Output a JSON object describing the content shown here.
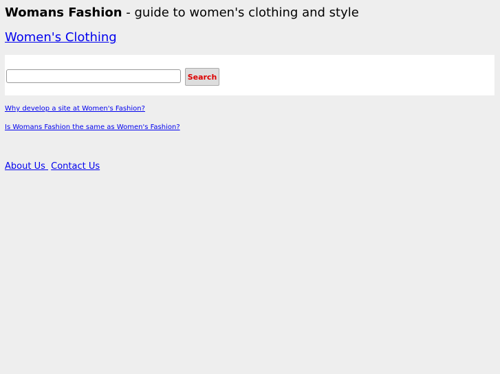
{
  "header": {
    "brand": "Womans Fashion",
    "tagline": " - guide to women's clothing and style"
  },
  "main_link": "Women's Clothing",
  "search": {
    "value": "",
    "placeholder": "",
    "button_label": "Search"
  },
  "faq_links": [
    "Why develop a site at Women's Fashion?",
    "Is Womans Fashion the same as Women's Fashion?"
  ],
  "footer": {
    "about": "About Us",
    "contact": "Contact Us"
  },
  "colors": {
    "background": "#eeeeee",
    "link": "#0000ee",
    "button_text": "#dd0000",
    "search_panel": "#ffffff"
  }
}
